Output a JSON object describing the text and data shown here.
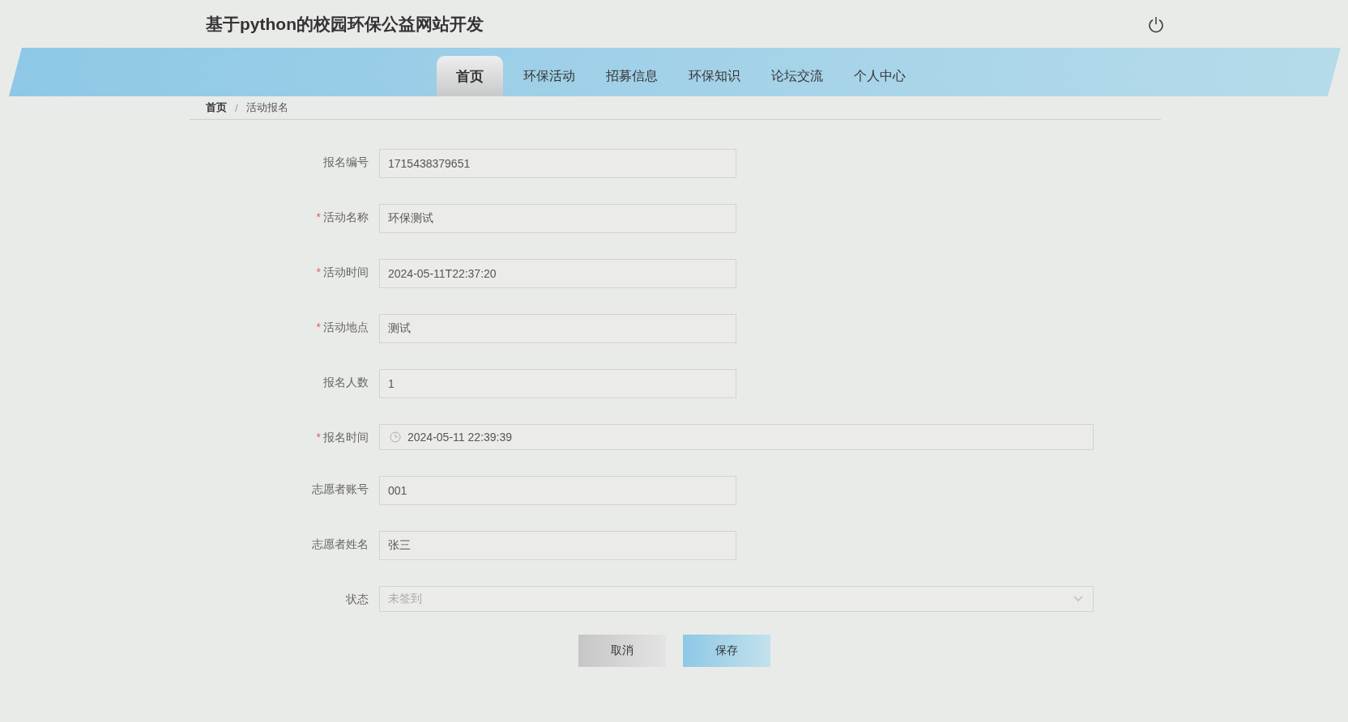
{
  "header": {
    "title": "基于python的校园环保公益网站开发"
  },
  "nav": [
    {
      "label": "首页",
      "selected": true
    },
    {
      "label": "环保活动",
      "selected": false
    },
    {
      "label": "招募信息",
      "selected": false
    },
    {
      "label": "环保知识",
      "selected": false
    },
    {
      "label": "论坛交流",
      "selected": false
    },
    {
      "label": "个人中心",
      "selected": false
    }
  ],
  "breadcrumb": {
    "items": [
      "首页",
      "活动报名"
    ],
    "separator": "/"
  },
  "form": {
    "fields": [
      {
        "label": "报名编号",
        "required": false,
        "kind": "text",
        "value": "1715438379651",
        "wide": false
      },
      {
        "label": "活动名称",
        "required": true,
        "kind": "text",
        "value": "环保测试",
        "wide": false
      },
      {
        "label": "活动时间",
        "required": true,
        "kind": "text",
        "value": "2024-05-11T22:37:20",
        "wide": false
      },
      {
        "label": "活动地点",
        "required": true,
        "kind": "text",
        "value": "测试",
        "wide": false
      },
      {
        "label": "报名人数",
        "required": false,
        "kind": "text",
        "value": "1",
        "wide": false
      },
      {
        "label": "报名时间",
        "required": true,
        "kind": "datetime",
        "value": "2024-05-11 22:39:39",
        "wide": true
      },
      {
        "label": "志愿者账号",
        "required": false,
        "kind": "text",
        "value": "001",
        "wide": false
      },
      {
        "label": "志愿者姓名",
        "required": false,
        "kind": "text",
        "value": "张三",
        "wide": false
      },
      {
        "label": "状态",
        "required": false,
        "kind": "select",
        "placeholder": "未签到",
        "wide": true
      }
    ],
    "required_mark": "*",
    "buttons": [
      {
        "label": "取消",
        "kind": "cancel"
      },
      {
        "label": "保存",
        "kind": "save"
      }
    ]
  }
}
